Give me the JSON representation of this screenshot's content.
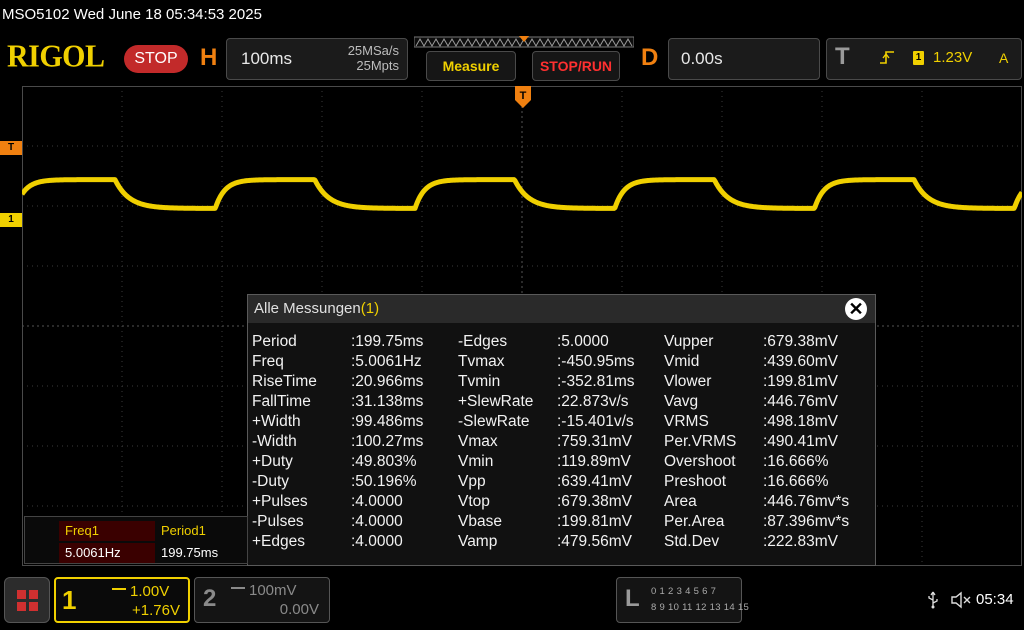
{
  "status_line": "MSO5102  Wed June 18 05:34:53 2025",
  "logo": "RIGOL",
  "run_state": "STOP",
  "horizontal": {
    "letter": "H",
    "timebase": "100ms",
    "sample_rate": "25MSa/s",
    "memory_depth": "25Mpts"
  },
  "buttons": {
    "measure": "Measure",
    "stop_run": "STOP/RUN"
  },
  "delay": {
    "letter": "D",
    "value": "0.00s"
  },
  "trigger": {
    "letter": "T",
    "source": "1",
    "level": "1.23V",
    "mode": "A",
    "slope_icon": "rising-edge-icon"
  },
  "markers": {
    "trigger_level": "T",
    "channel1": "1"
  },
  "waveform": {
    "channel": "1",
    "color": "#f0d000",
    "period_ms": 199.75,
    "duty_percent": 49.803,
    "vtop_mV": 679.38,
    "vbase_mV": 199.81,
    "rise_time_ms": 20.966,
    "fall_time_ms": 31.138
  },
  "measurements": {
    "title": "Alle Messungen",
    "channel": "(1)",
    "close_label": "✕",
    "rows": [
      [
        {
          "name": "Period",
          "value": ":199.75ms"
        },
        {
          "name": "-Edges",
          "value": ":5.0000"
        },
        {
          "name": "Vupper",
          "value": ":679.38mV"
        }
      ],
      [
        {
          "name": "Freq",
          "value": ":5.0061Hz"
        },
        {
          "name": "Tvmax",
          "value": ":-450.95ms"
        },
        {
          "name": "Vmid",
          "value": ":439.60mV"
        }
      ],
      [
        {
          "name": "RiseTime",
          "value": ":20.966ms"
        },
        {
          "name": "Tvmin",
          "value": ":-352.81ms"
        },
        {
          "name": "Vlower",
          "value": ":199.81mV"
        }
      ],
      [
        {
          "name": "FallTime",
          "value": ":31.138ms"
        },
        {
          "name": "+SlewRate",
          "value": ":22.873v/s"
        },
        {
          "name": "Vavg",
          "value": ":446.76mV"
        }
      ],
      [
        {
          "name": "+Width",
          "value": ":99.486ms"
        },
        {
          "name": "-SlewRate",
          "value": ":-15.401v/s"
        },
        {
          "name": "VRMS",
          "value": ":498.18mV"
        }
      ],
      [
        {
          "name": "-Width",
          "value": ":100.27ms"
        },
        {
          "name": "Vmax",
          "value": ":759.31mV"
        },
        {
          "name": "Per.VRMS",
          "value": ":490.41mV"
        }
      ],
      [
        {
          "name": "+Duty",
          "value": ":49.803%"
        },
        {
          "name": "Vmin",
          "value": ":119.89mV"
        },
        {
          "name": "Overshoot",
          "value": ":16.666%"
        }
      ],
      [
        {
          "name": "-Duty",
          "value": ":50.196%"
        },
        {
          "name": "Vpp",
          "value": ":639.41mV"
        },
        {
          "name": "Preshoot",
          "value": ":16.666%"
        }
      ],
      [
        {
          "name": "+Pulses",
          "value": ":4.0000"
        },
        {
          "name": "Vtop",
          "value": ":679.38mV"
        },
        {
          "name": "Area",
          "value": ":446.76mv*s"
        }
      ],
      [
        {
          "name": "-Pulses",
          "value": ":4.0000"
        },
        {
          "name": "Vbase",
          "value": ":199.81mV"
        },
        {
          "name": "Per.Area",
          "value": ":87.396mv*s"
        }
      ],
      [
        {
          "name": "+Edges",
          "value": ":4.0000"
        },
        {
          "name": "Vamp",
          "value": ":479.56mV"
        },
        {
          "name": "Std.Dev",
          "value": ":222.83mV"
        }
      ]
    ]
  },
  "stats": {
    "item1": {
      "label": "Freq1",
      "value": "5.0061Hz"
    },
    "item2": {
      "label": "Period1",
      "value": "199.75ms"
    }
  },
  "channels": {
    "ch1": {
      "number": "1",
      "scale": "1.00V",
      "offset": "+1.76V"
    },
    "ch2": {
      "number": "2",
      "scale": "100mV",
      "offset": "0.00V"
    }
  },
  "logic": {
    "letter": "L",
    "row1": "0 1 2 3  4 5 6 7",
    "row2": "8 9 10 11  12 13 14 15"
  },
  "clock": "05:34"
}
